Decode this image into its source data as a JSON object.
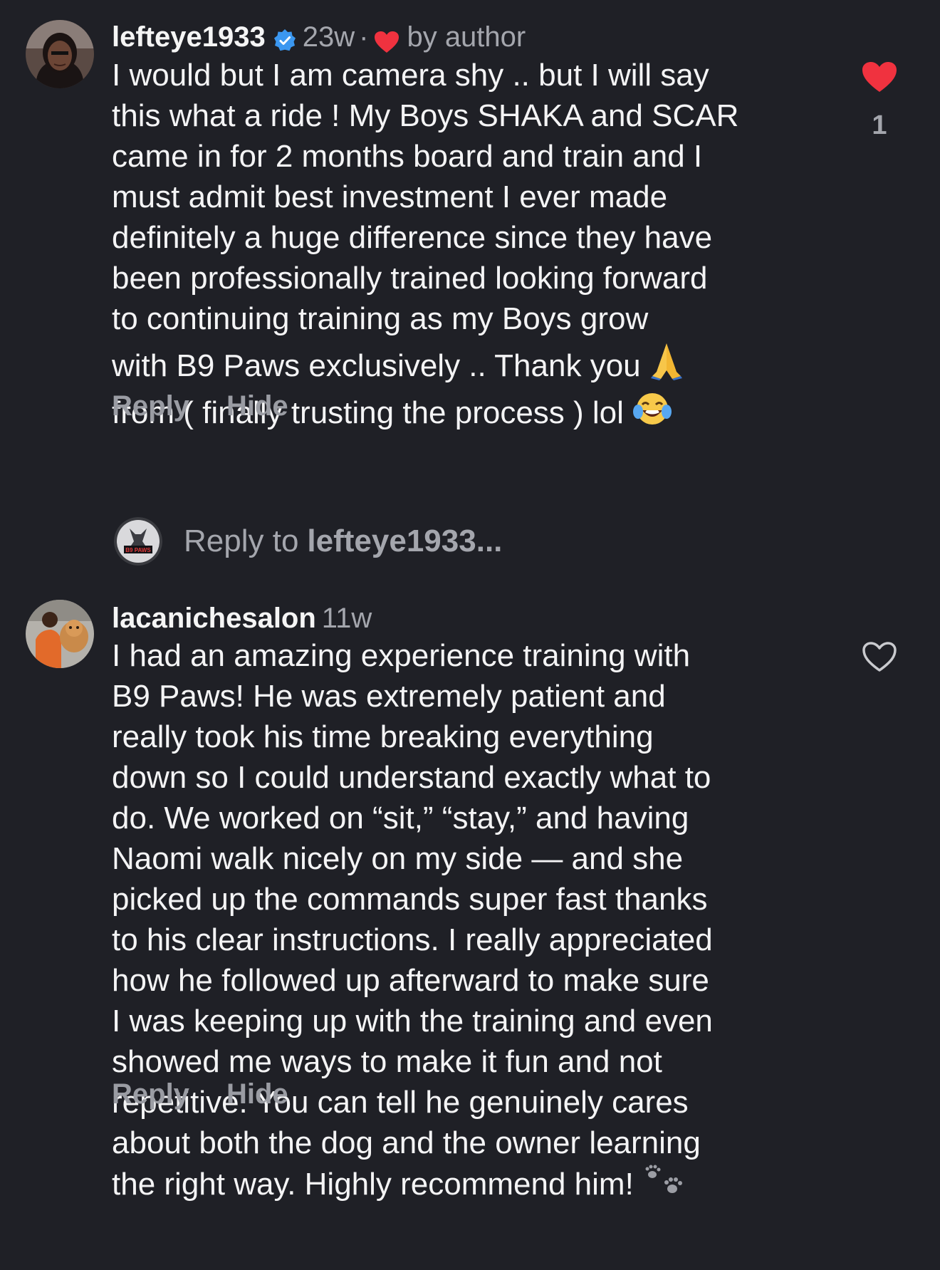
{
  "comments": [
    {
      "username": "lefteye1933",
      "verified": true,
      "time": "23w",
      "separator": "·",
      "liked_by_author": "by author",
      "text": "I would but I am camera shy .. but I will say\nthis what a ride ! My Boys SHAKA and SCAR\ncame in for 2 months board and train and I\nmust admit best investment I ever made\ndefinitely a huge difference since they have\nbeen professionally trained looking forward\nto  continuing training as my Boys grow\nwith B9 Paws exclusively .. Thank you",
      "text_last": "from ( finally trusting the process ) lol",
      "emojis": [
        "folded-hands-icon",
        "tears-of-joy-icon"
      ],
      "reply_label": "Reply",
      "hide_label": "Hide",
      "like_count": "1",
      "liked": true,
      "colors": {
        "heart": "#f0323f",
        "verified": "#3b97f0"
      }
    },
    {
      "username": "lacanichesalon",
      "time": "11w",
      "text": "I had an amazing experience training with\nB9 Paws! He was extremely patient and\nreally took his time breaking everything\ndown so I could understand exactly what to\ndo. We worked on “sit,” “stay,” and having\nNaomi walk nicely on my side — and she\npicked up the commands super fast thanks\nto his clear instructions. I really appreciated\nhow he followed up afterward to make sure\nI was keeping up with the training and even\nshowed me ways to make it fun and not\nrepetitive. You can tell he genuinely cares\nabout both the dog and the owner learning",
      "text_last": "the right way. Highly recommend him!",
      "emojis": [
        "paw-prints-icon"
      ],
      "reply_label": "Reply",
      "hide_label": "Hide",
      "liked": false
    }
  ],
  "reply_prompt": {
    "prefix": "Reply to",
    "target": "lefteye1933...",
    "logo_text": "B9 PAWS"
  },
  "colors": {
    "background": "#1f2026",
    "secondary_text": "#a4a6ad"
  }
}
